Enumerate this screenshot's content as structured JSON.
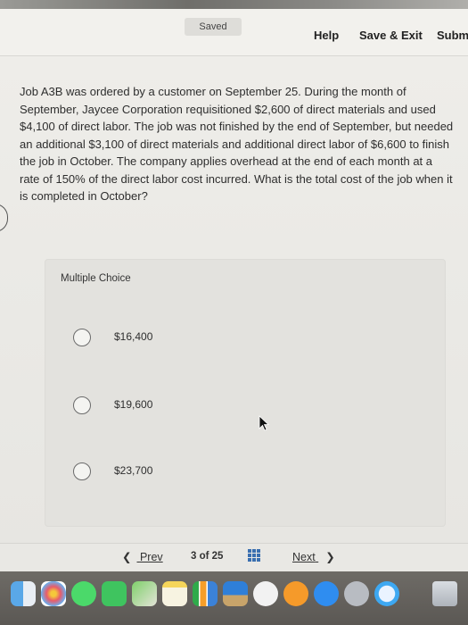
{
  "header": {
    "saved_label": "Saved",
    "help_label": "Help",
    "save_exit_label": "Save & Exit",
    "submit_label": "Subm"
  },
  "question": {
    "text": "Job A3B was ordered by a customer on September 25. During the month of September, Jaycee Corporation requisitioned $2,600 of direct materials and used $4,100 of direct labor. The job was not finished by the end of September, but needed an additional $3,100 of direct materials and additional direct labor of $6,600 to finish the job in October. The company applies overhead at the end of each month at a rate of 150% of the direct labor cost incurred. What is the total cost of the job when it is completed in October?"
  },
  "multiple_choice": {
    "label": "Multiple Choice",
    "options": [
      {
        "value": "$16,400"
      },
      {
        "value": "$19,600"
      },
      {
        "value": "$23,700"
      }
    ]
  },
  "nav": {
    "prev_label": "Prev",
    "page_indicator": "3 of 25",
    "next_label": "Next"
  },
  "colors": {
    "accent_blue": "#3a6fb0",
    "page_bg": "#efeeea",
    "panel_bg": "#e3e2de"
  },
  "dock_icons": [
    "finder-icon",
    "photos-icon",
    "messages-icon",
    "facetime-icon",
    "maps-icon",
    "notes-icon",
    "numbers-icon",
    "keynote-icon",
    "music-icon",
    "books-icon",
    "app-store-icon",
    "system-preferences-icon",
    "safari-icon",
    "trash-icon"
  ]
}
